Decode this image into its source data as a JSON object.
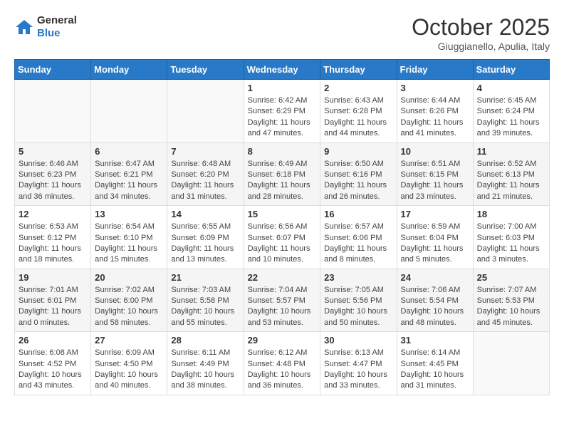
{
  "header": {
    "logo_line1": "General",
    "logo_line2": "Blue",
    "month": "October 2025",
    "location": "Giuggianello, Apulia, Italy"
  },
  "weekdays": [
    "Sunday",
    "Monday",
    "Tuesday",
    "Wednesday",
    "Thursday",
    "Friday",
    "Saturday"
  ],
  "weeks": [
    [
      {
        "day": "",
        "info": ""
      },
      {
        "day": "",
        "info": ""
      },
      {
        "day": "",
        "info": ""
      },
      {
        "day": "1",
        "info": "Sunrise: 6:42 AM\nSunset: 6:29 PM\nDaylight: 11 hours and 47 minutes."
      },
      {
        "day": "2",
        "info": "Sunrise: 6:43 AM\nSunset: 6:28 PM\nDaylight: 11 hours and 44 minutes."
      },
      {
        "day": "3",
        "info": "Sunrise: 6:44 AM\nSunset: 6:26 PM\nDaylight: 11 hours and 41 minutes."
      },
      {
        "day": "4",
        "info": "Sunrise: 6:45 AM\nSunset: 6:24 PM\nDaylight: 11 hours and 39 minutes."
      }
    ],
    [
      {
        "day": "5",
        "info": "Sunrise: 6:46 AM\nSunset: 6:23 PM\nDaylight: 11 hours and 36 minutes."
      },
      {
        "day": "6",
        "info": "Sunrise: 6:47 AM\nSunset: 6:21 PM\nDaylight: 11 hours and 34 minutes."
      },
      {
        "day": "7",
        "info": "Sunrise: 6:48 AM\nSunset: 6:20 PM\nDaylight: 11 hours and 31 minutes."
      },
      {
        "day": "8",
        "info": "Sunrise: 6:49 AM\nSunset: 6:18 PM\nDaylight: 11 hours and 28 minutes."
      },
      {
        "day": "9",
        "info": "Sunrise: 6:50 AM\nSunset: 6:16 PM\nDaylight: 11 hours and 26 minutes."
      },
      {
        "day": "10",
        "info": "Sunrise: 6:51 AM\nSunset: 6:15 PM\nDaylight: 11 hours and 23 minutes."
      },
      {
        "day": "11",
        "info": "Sunrise: 6:52 AM\nSunset: 6:13 PM\nDaylight: 11 hours and 21 minutes."
      }
    ],
    [
      {
        "day": "12",
        "info": "Sunrise: 6:53 AM\nSunset: 6:12 PM\nDaylight: 11 hours and 18 minutes."
      },
      {
        "day": "13",
        "info": "Sunrise: 6:54 AM\nSunset: 6:10 PM\nDaylight: 11 hours and 15 minutes."
      },
      {
        "day": "14",
        "info": "Sunrise: 6:55 AM\nSunset: 6:09 PM\nDaylight: 11 hours and 13 minutes."
      },
      {
        "day": "15",
        "info": "Sunrise: 6:56 AM\nSunset: 6:07 PM\nDaylight: 11 hours and 10 minutes."
      },
      {
        "day": "16",
        "info": "Sunrise: 6:57 AM\nSunset: 6:06 PM\nDaylight: 11 hours and 8 minutes."
      },
      {
        "day": "17",
        "info": "Sunrise: 6:59 AM\nSunset: 6:04 PM\nDaylight: 11 hours and 5 minutes."
      },
      {
        "day": "18",
        "info": "Sunrise: 7:00 AM\nSunset: 6:03 PM\nDaylight: 11 hours and 3 minutes."
      }
    ],
    [
      {
        "day": "19",
        "info": "Sunrise: 7:01 AM\nSunset: 6:01 PM\nDaylight: 11 hours and 0 minutes."
      },
      {
        "day": "20",
        "info": "Sunrise: 7:02 AM\nSunset: 6:00 PM\nDaylight: 10 hours and 58 minutes."
      },
      {
        "day": "21",
        "info": "Sunrise: 7:03 AM\nSunset: 5:58 PM\nDaylight: 10 hours and 55 minutes."
      },
      {
        "day": "22",
        "info": "Sunrise: 7:04 AM\nSunset: 5:57 PM\nDaylight: 10 hours and 53 minutes."
      },
      {
        "day": "23",
        "info": "Sunrise: 7:05 AM\nSunset: 5:56 PM\nDaylight: 10 hours and 50 minutes."
      },
      {
        "day": "24",
        "info": "Sunrise: 7:06 AM\nSunset: 5:54 PM\nDaylight: 10 hours and 48 minutes."
      },
      {
        "day": "25",
        "info": "Sunrise: 7:07 AM\nSunset: 5:53 PM\nDaylight: 10 hours and 45 minutes."
      }
    ],
    [
      {
        "day": "26",
        "info": "Sunrise: 6:08 AM\nSunset: 4:52 PM\nDaylight: 10 hours and 43 minutes."
      },
      {
        "day": "27",
        "info": "Sunrise: 6:09 AM\nSunset: 4:50 PM\nDaylight: 10 hours and 40 minutes."
      },
      {
        "day": "28",
        "info": "Sunrise: 6:11 AM\nSunset: 4:49 PM\nDaylight: 10 hours and 38 minutes."
      },
      {
        "day": "29",
        "info": "Sunrise: 6:12 AM\nSunset: 4:48 PM\nDaylight: 10 hours and 36 minutes."
      },
      {
        "day": "30",
        "info": "Sunrise: 6:13 AM\nSunset: 4:47 PM\nDaylight: 10 hours and 33 minutes."
      },
      {
        "day": "31",
        "info": "Sunrise: 6:14 AM\nSunset: 4:45 PM\nDaylight: 10 hours and 31 minutes."
      },
      {
        "day": "",
        "info": ""
      }
    ]
  ]
}
